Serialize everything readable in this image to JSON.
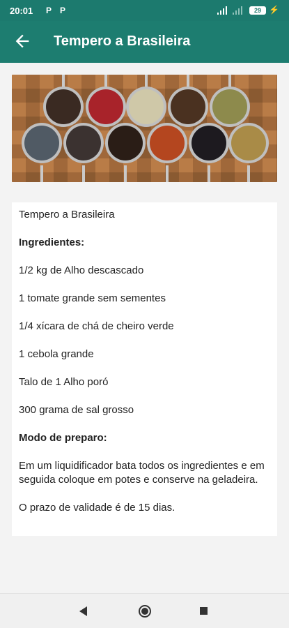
{
  "status": {
    "time": "20:01",
    "notif_icons": [
      "P",
      "P"
    ],
    "battery": "29"
  },
  "app_bar": {
    "title": "Tempero a Brasileira"
  },
  "hero_image": {
    "icon": "spices-photo"
  },
  "recipe": {
    "title": "Tempero a Brasileira",
    "ingredients_heading": "Ingredientes:",
    "ingredients": [
      "1/2 kg de Alho descascado",
      "1 tomate grande sem sementes",
      "1/4 xícara de chá de cheiro verde",
      "1 cebola grande",
      "Talo de 1 Alho poró",
      "300 grama de sal grosso"
    ],
    "method_heading": "Modo de preparo:",
    "method": "Em um liquidificador bata todos os ingredientes e em seguida coloque em potes e conserve na geladeira.",
    "validity": "O prazo de validade é de 15 dias."
  },
  "colors": {
    "primary": "#1d7d70",
    "status": "#1c7a6e",
    "background": "#f3f3f3"
  }
}
